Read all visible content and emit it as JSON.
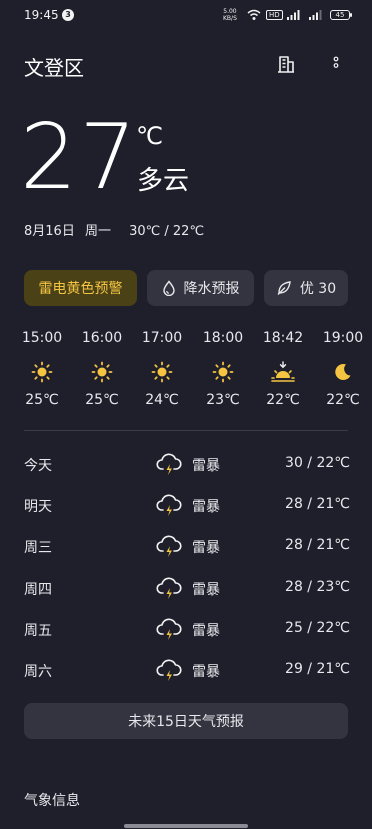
{
  "status_bar": {
    "time": "19:45",
    "notification_count": "3",
    "net_speed_value": "5.00",
    "net_speed_unit": "KB/S",
    "hd_label": "HD",
    "battery": "45"
  },
  "header": {
    "city": "文登区",
    "icons": [
      "building-icon",
      "more-vertical-icon"
    ]
  },
  "current": {
    "temperature": "27",
    "unit": "℃",
    "condition": "多云",
    "date": "8月16日",
    "weekday": "周一",
    "range": "30℃ / 22℃"
  },
  "chips": {
    "alert": "雷电黄色预警",
    "precip": "降水预报",
    "aqi": "优 30"
  },
  "hourly": [
    {
      "time": "15:00",
      "icon": "sun-icon",
      "temp": "25℃"
    },
    {
      "time": "16:00",
      "icon": "sun-icon",
      "temp": "25℃"
    },
    {
      "time": "17:00",
      "icon": "sun-icon",
      "temp": "24℃"
    },
    {
      "time": "18:00",
      "icon": "sun-icon",
      "temp": "23℃"
    },
    {
      "time": "18:42",
      "icon": "sunset-icon",
      "temp": "22℃"
    },
    {
      "time": "19:00",
      "icon": "moon-icon",
      "temp": "22℃"
    }
  ],
  "daily": [
    {
      "day": "今天",
      "icon": "thunderstorm-icon",
      "condition": "雷暴",
      "range": "30 / 22℃"
    },
    {
      "day": "明天",
      "icon": "thunderstorm-icon",
      "condition": "雷暴",
      "range": "28 / 21℃"
    },
    {
      "day": "周三",
      "icon": "thunderstorm-icon",
      "condition": "雷暴",
      "range": "28 / 21℃"
    },
    {
      "day": "周四",
      "icon": "thunderstorm-icon",
      "condition": "雷暴",
      "range": "28 / 23℃"
    },
    {
      "day": "周五",
      "icon": "thunderstorm-icon",
      "condition": "雷暴",
      "range": "25 / 22℃"
    },
    {
      "day": "周六",
      "icon": "thunderstorm-icon",
      "condition": "雷暴",
      "range": "29 / 21℃"
    }
  ],
  "forecast_button": "未来15日天气预报",
  "section_title": "气象信息",
  "colors": {
    "background": "#1e1f2b",
    "card": "#33343f",
    "alert_bg": "#4a4117",
    "alert_text": "#f5c542",
    "sun": "#f5c542"
  }
}
